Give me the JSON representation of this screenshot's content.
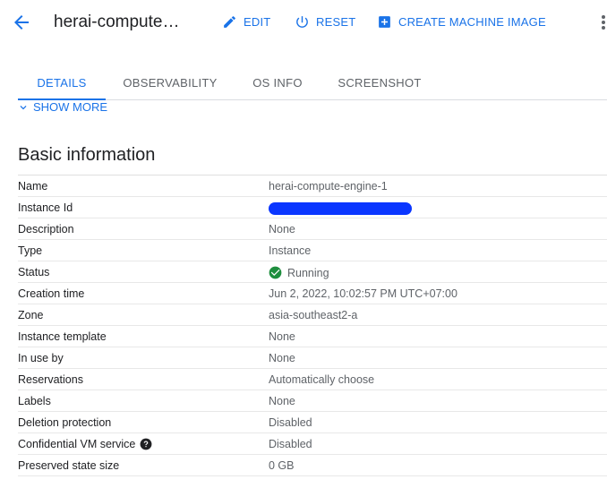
{
  "header": {
    "title": "herai-compute…",
    "actions": {
      "edit": "EDIT",
      "reset": "RESET",
      "create_image": "CREATE MACHINE IMAGE"
    }
  },
  "tabs": [
    {
      "label": "DETAILS",
      "active": true
    },
    {
      "label": "OBSERVABILITY",
      "active": false
    },
    {
      "label": "OS INFO",
      "active": false
    },
    {
      "label": "SCREENSHOT",
      "active": false
    }
  ],
  "show_more": "SHOW MORE",
  "section_title": "Basic information",
  "rows": [
    {
      "label": "Name",
      "value": "herai-compute-engine-1"
    },
    {
      "label": "Instance Id",
      "value": ""
    },
    {
      "label": "Description",
      "value": "None"
    },
    {
      "label": "Type",
      "value": "Instance"
    },
    {
      "label": "Status",
      "value": "Running"
    },
    {
      "label": "Creation time",
      "value": "Jun 2, 2022, 10:02:57 PM UTC+07:00"
    },
    {
      "label": "Zone",
      "value": "asia-southeast2-a"
    },
    {
      "label": "Instance template",
      "value": "None"
    },
    {
      "label": "In use by",
      "value": "None"
    },
    {
      "label": "Reservations",
      "value": "Automatically choose"
    },
    {
      "label": "Labels",
      "value": "None"
    },
    {
      "label": "Deletion protection",
      "value": "Disabled"
    },
    {
      "label": "Confidential VM service",
      "value": "Disabled"
    },
    {
      "label": "Preserved state size",
      "value": "0 GB"
    }
  ],
  "colors": {
    "accent": "#1a73e8",
    "status_running": "#1e8e3e",
    "redaction": "#0a36ff"
  },
  "icons": {
    "back": "arrow-back-icon",
    "edit": "pencil-icon",
    "reset": "power-icon",
    "create": "add-box-icon",
    "more": "more-vert-icon",
    "show_more": "chevron-down-icon",
    "status": "check-circle-icon",
    "help": "help-icon"
  }
}
